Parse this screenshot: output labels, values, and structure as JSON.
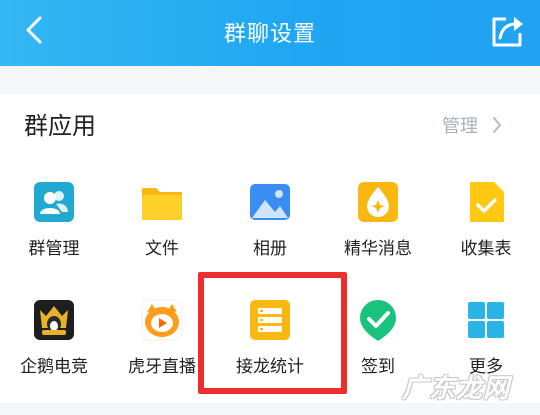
{
  "header": {
    "title": "群聊设置",
    "back_icon": "chevron-left-icon",
    "share_icon": "share-icon",
    "bg_color": "#1fa7f3"
  },
  "section": {
    "title": "群应用",
    "manage_label": "管理"
  },
  "apps_row1": [
    {
      "label": "群管理",
      "icon": "group-manage-icon"
    },
    {
      "label": "文件",
      "icon": "folder-icon"
    },
    {
      "label": "相册",
      "icon": "photo-album-icon"
    },
    {
      "label": "精华消息",
      "icon": "essence-message-icon"
    },
    {
      "label": "收集表",
      "icon": "collection-form-icon"
    }
  ],
  "apps_row2": [
    {
      "label": "企鹅电竞",
      "icon": "penguin-esports-icon"
    },
    {
      "label": "虎牙直播",
      "icon": "huya-live-icon"
    },
    {
      "label": "接龙统计",
      "icon": "relay-stats-icon"
    },
    {
      "label": "签到",
      "icon": "check-in-icon"
    },
    {
      "label": "更多",
      "icon": "more-grid-icon"
    }
  ],
  "highlight_color": "#ee2d2d",
  "watermark": "广东龙网"
}
